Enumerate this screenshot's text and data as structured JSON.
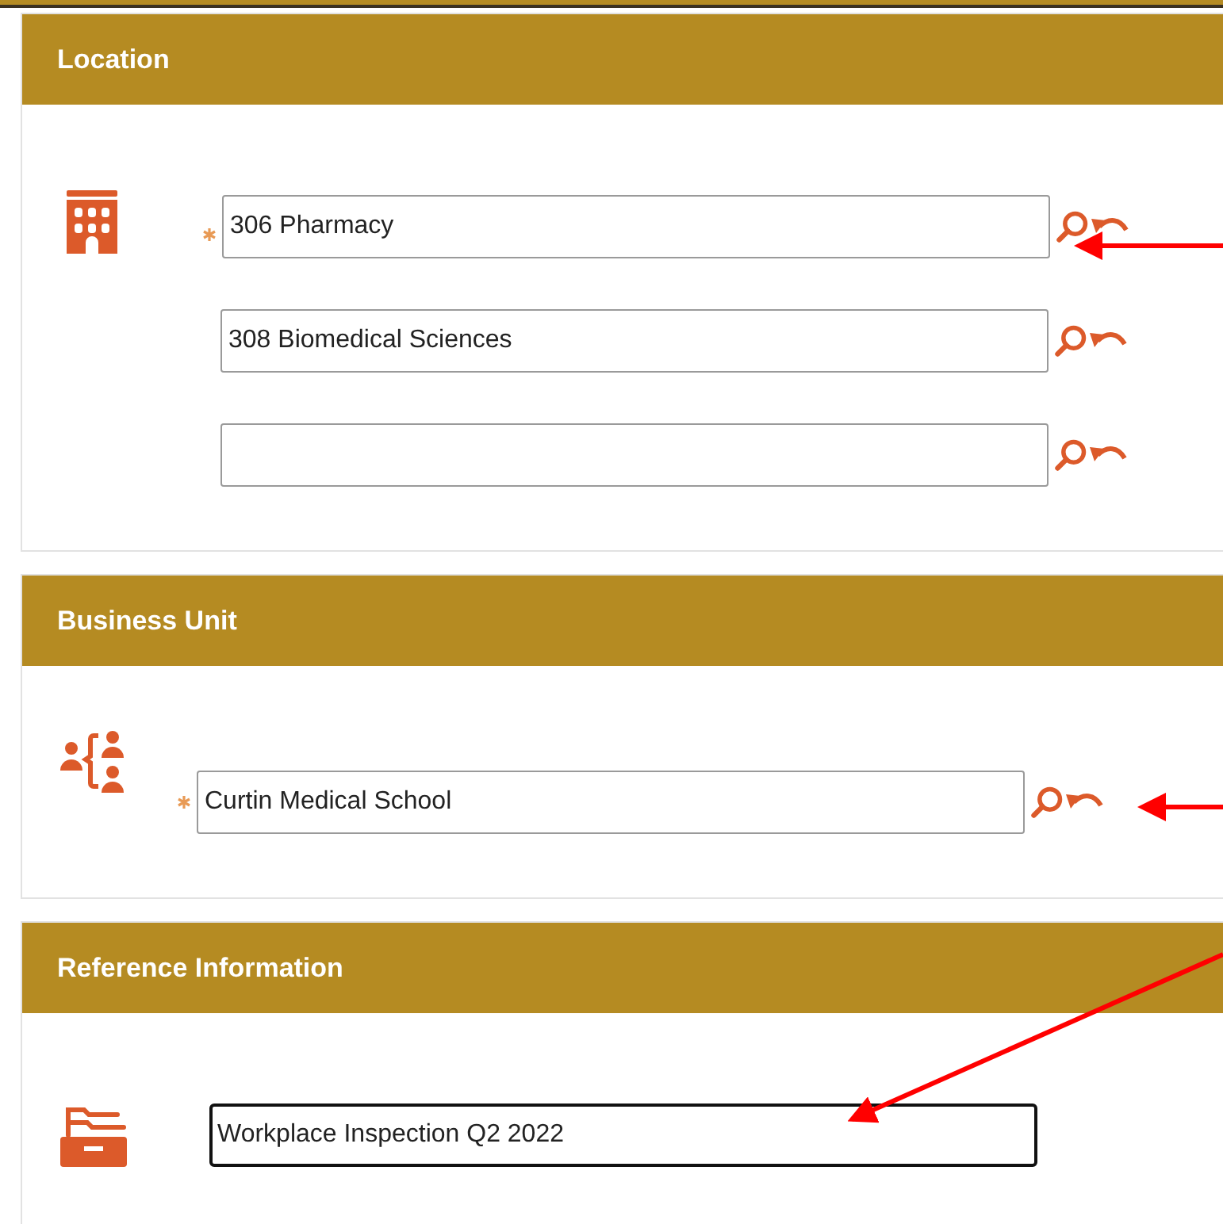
{
  "sections": [
    {
      "title": "Location",
      "fields": [
        {
          "value": "306 Pharmacy",
          "required": true,
          "focused": false,
          "kind": "lookup"
        },
        {
          "value": "308 Biomedical Sciences",
          "required": false,
          "focused": false,
          "kind": "lookup"
        },
        {
          "required": false,
          "focused": false,
          "kind": "lookup"
        }
      ]
    },
    {
      "title": "Business Unit",
      "fields": [
        {
          "value": "Curtin Medical School",
          "required": true,
          "focused": false,
          "kind": "lookup"
        }
      ]
    },
    {
      "title": "Reference Information",
      "fields": [
        {
          "value": "Workplace Inspection Q2 2022",
          "required": false,
          "focused": true,
          "kind": "text"
        }
      ]
    }
  ]
}
